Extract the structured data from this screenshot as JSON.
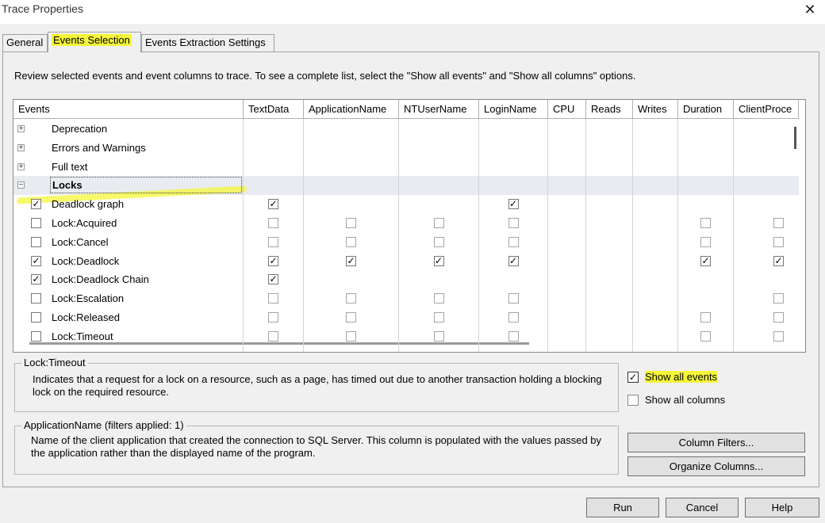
{
  "window": {
    "title": "Trace Properties"
  },
  "tabs": [
    {
      "label": "General"
    },
    {
      "label": "Events Selection"
    },
    {
      "label": "Events Extraction Settings"
    }
  ],
  "description": "Review selected events and event columns to trace. To see a complete list, select the \"Show all events\" and \"Show all columns\" options.",
  "grid": {
    "columns": [
      "Events",
      "TextData",
      "ApplicationName",
      "NTUserName",
      "LoginName",
      "CPU",
      "Reads",
      "Writes",
      "Duration",
      "ClientProce"
    ],
    "rows": [
      {
        "label": "Deprecation",
        "type": "category",
        "expander": "+"
      },
      {
        "label": "Errors and Warnings",
        "type": "category",
        "expander": "+"
      },
      {
        "label": "Full text",
        "type": "category",
        "expander": "+"
      },
      {
        "label": "Locks",
        "type": "category",
        "expander": "−"
      },
      {
        "label": "Deadlock graph",
        "checked": true,
        "cells": [
          "checked",
          "",
          "",
          "checked",
          "",
          "",
          "",
          "",
          ""
        ]
      },
      {
        "label": "Lock:Acquired",
        "checked": false,
        "cells": [
          "empty",
          "empty",
          "empty",
          "empty",
          "",
          "",
          "",
          "empty",
          "empty"
        ]
      },
      {
        "label": "Lock:Cancel",
        "checked": false,
        "cells": [
          "empty",
          "empty",
          "empty",
          "empty",
          "",
          "",
          "",
          "empty",
          "empty"
        ]
      },
      {
        "label": "Lock:Deadlock",
        "checked": true,
        "cells": [
          "checked",
          "checked",
          "checked",
          "checked",
          "",
          "",
          "",
          "checked",
          "checked"
        ]
      },
      {
        "label": "Lock:Deadlock Chain",
        "checked": true,
        "cells": [
          "checked",
          "",
          "",
          "",
          "",
          "",
          "",
          "",
          ""
        ]
      },
      {
        "label": "Lock:Escalation",
        "checked": false,
        "cells": [
          "empty",
          "empty",
          "empty",
          "empty",
          "",
          "",
          "",
          "",
          "empty"
        ]
      },
      {
        "label": "Lock:Released",
        "checked": false,
        "cells": [
          "empty",
          "empty",
          "empty",
          "empty",
          "",
          "",
          "",
          "empty",
          "empty"
        ]
      },
      {
        "label": "Lock:Timeout",
        "checked": false,
        "cells": [
          "empty",
          "empty",
          "empty",
          "empty",
          "",
          "",
          "",
          "empty",
          "empty"
        ]
      }
    ]
  },
  "event_info": {
    "legend": "Lock:Timeout",
    "text": "Indicates that a request for a lock on a resource, such as a page, has timed out due to another transaction holding a blocking lock on the required resource."
  },
  "column_info": {
    "legend": "ApplicationName (filters applied: 1)",
    "text": "Name of the client application that created the connection to SQL Server. This column is populated with the values passed by the application rather than the displayed name of the program."
  },
  "options": {
    "show_all_events": {
      "label": "Show all events",
      "checked": true
    },
    "show_all_columns": {
      "label": "Show all columns",
      "checked": false
    }
  },
  "buttons": {
    "column_filters": "Column Filters...",
    "organize_columns": "Organize Columns...",
    "run": "Run",
    "cancel": "Cancel",
    "help": "Help"
  },
  "colors": {
    "highlight": "#f5f53a",
    "locks_row": "#e8ecf0"
  },
  "icons": {
    "close": "close-icon",
    "expand": "plus-icon",
    "collapse": "minus-icon",
    "check": "checkmark-icon"
  }
}
